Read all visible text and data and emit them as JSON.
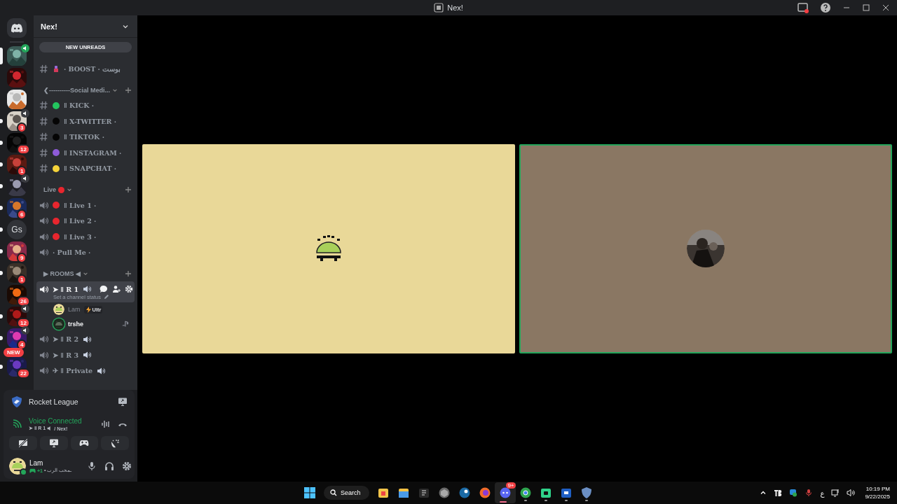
{
  "window": {
    "title": "Nex!"
  },
  "servers": [
    {
      "kind": "picture",
      "selected": true,
      "in_voice": true,
      "connected": true
    },
    {
      "kind": "picture",
      "selected": false,
      "unread": false
    },
    {
      "kind": "picture",
      "selected": false,
      "unread": false
    },
    {
      "kind": "picture",
      "selected": false,
      "unread": true,
      "badge": "3",
      "in_voice": true,
      "connected": false
    },
    {
      "kind": "picture",
      "selected": false,
      "unread": true,
      "badge": "12"
    },
    {
      "kind": "picture",
      "selected": false,
      "unread": true,
      "badge": "1"
    },
    {
      "kind": "picture",
      "selected": false,
      "unread": true,
      "in_voice": true,
      "connected": false
    },
    {
      "kind": "picture",
      "selected": false,
      "unread": true,
      "badge": "6"
    },
    {
      "kind": "text",
      "label": "Gs",
      "selected": false,
      "unread": true
    },
    {
      "kind": "picture",
      "selected": false,
      "unread": true,
      "badge": "9"
    },
    {
      "kind": "picture",
      "selected": false,
      "unread": true,
      "badge": "1"
    },
    {
      "kind": "picture",
      "selected": false,
      "unread": false,
      "badge": "26"
    },
    {
      "kind": "picture",
      "selected": false,
      "unread": true,
      "badge": "12",
      "in_voice": true,
      "connected": false
    },
    {
      "kind": "picture",
      "selected": false,
      "unread": true,
      "badge": "4",
      "in_voice": true,
      "connected": false
    },
    {
      "kind": "picture",
      "selected": false,
      "unread": true,
      "badge": "22",
      "new_label": "NEW"
    }
  ],
  "server_name": "Nex!",
  "new_unreads": "NEW UNREADS",
  "channels": [
    {
      "kind": "text",
      "emoji": true,
      "name": "· BOOST · بوست",
      "selected": false
    },
    {
      "kind": "category",
      "name": "❮----------Social Medi..."
    },
    {
      "kind": "text",
      "color": "#23c45e",
      "name": "ǁ KICK ·",
      "selected": false
    },
    {
      "kind": "text",
      "color": "#050505",
      "name": "ǁ X-TWITTER ·",
      "selected": false
    },
    {
      "kind": "text",
      "color": "#050505",
      "name": "ǁ TIKTOK ·",
      "selected": false
    },
    {
      "kind": "text",
      "color": "#8e5bd8",
      "name": "ǁ INSTAGRAM ·",
      "selected": false
    },
    {
      "kind": "text",
      "color": "#f5d33a",
      "name": "ǁ SNAPCHAT ·",
      "selected": false
    },
    {
      "kind": "category",
      "name": "Live",
      "color": "#e8262e"
    },
    {
      "kind": "voice",
      "color": "#e8262e",
      "name": "ǁ Live 1 ·",
      "selected": false
    },
    {
      "kind": "voice",
      "color": "#e8262e",
      "name": "ǁ Live 2 ·",
      "selected": false
    },
    {
      "kind": "voice",
      "color": "#e8262e",
      "name": "ǁ Live 3 ·",
      "selected": false
    },
    {
      "kind": "voice",
      "name": "· Pull Me ·",
      "selected": false
    },
    {
      "kind": "category",
      "name": "▶ ROOMS ◀"
    },
    {
      "kind": "voice",
      "name": "➤ ǁ R 1",
      "speaker_emoji": true,
      "selected": true,
      "status_hint": "Set a channel status",
      "users": [
        {
          "name": "Lam",
          "speaking": false,
          "tag": "Ultr"
        },
        {
          "name": "trshe",
          "speaking": true,
          "console": true
        }
      ]
    },
    {
      "kind": "voice",
      "name": "➤ ǁ R 2",
      "speaker_emoji": true,
      "selected": false
    },
    {
      "kind": "voice",
      "name": "➤ ǁ R 3",
      "speaker_emoji": true,
      "selected": false
    },
    {
      "kind": "voice",
      "name": "✈ ǁ Private",
      "speaker_emoji": true,
      "selected": false
    }
  ],
  "activity": {
    "name": "Rocket League"
  },
  "voice": {
    "status": "Voice Connected",
    "channel": "➤ ǁ R 1",
    "server": "/ Nex!"
  },
  "user": {
    "name": "Lam",
    "online": true,
    "activity_count": "+1",
    "custom_status": "• ـمحب الرب"
  },
  "tiles": [
    {
      "color": "#e9d898",
      "speaking": false,
      "kind": "pixel"
    },
    {
      "color": "#8a7763",
      "speaking": true,
      "kind": "picture"
    }
  ],
  "taskbar": {
    "search": "Search",
    "apps": [
      {
        "kind": "store",
        "running": false,
        "selected": false
      },
      {
        "kind": "files",
        "running": false,
        "selected": false
      },
      {
        "kind": "epic",
        "running": false,
        "selected": false
      },
      {
        "kind": "cube",
        "running": false,
        "selected": false
      },
      {
        "kind": "steam",
        "running": false,
        "selected": false
      },
      {
        "kind": "firefox",
        "running": false,
        "selected": false
      },
      {
        "kind": "discord",
        "running": true,
        "selected": true,
        "badge": "9+"
      },
      {
        "kind": "chrome",
        "running": true,
        "selected": false
      },
      {
        "kind": "chat",
        "running": true,
        "selected": false
      },
      {
        "kind": "remote",
        "running": true,
        "selected": false
      },
      {
        "kind": "shield",
        "running": true,
        "selected": false
      }
    ],
    "language": "ع",
    "time": "10:19 PM",
    "date": "9/22/2025"
  }
}
